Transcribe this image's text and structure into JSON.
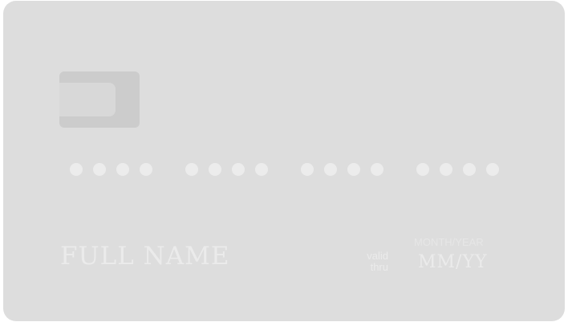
{
  "card": {
    "number_groups": [
      [
        "•",
        "•",
        "•",
        "•"
      ],
      [
        "•",
        "•",
        "•",
        "•"
      ],
      [
        "•",
        "•",
        "•",
        "•"
      ],
      [
        "•",
        "•",
        "•",
        "•"
      ]
    ],
    "holder_name": "FULL NAME",
    "valid_line1": "valid",
    "valid_line2": "thru",
    "expiry_caption": "MONTH/YEAR",
    "expiry_value": "MM/YY"
  },
  "colors": {
    "card_background": "#dddddd",
    "chip": "#cccccc",
    "text": "#ebebeb"
  }
}
